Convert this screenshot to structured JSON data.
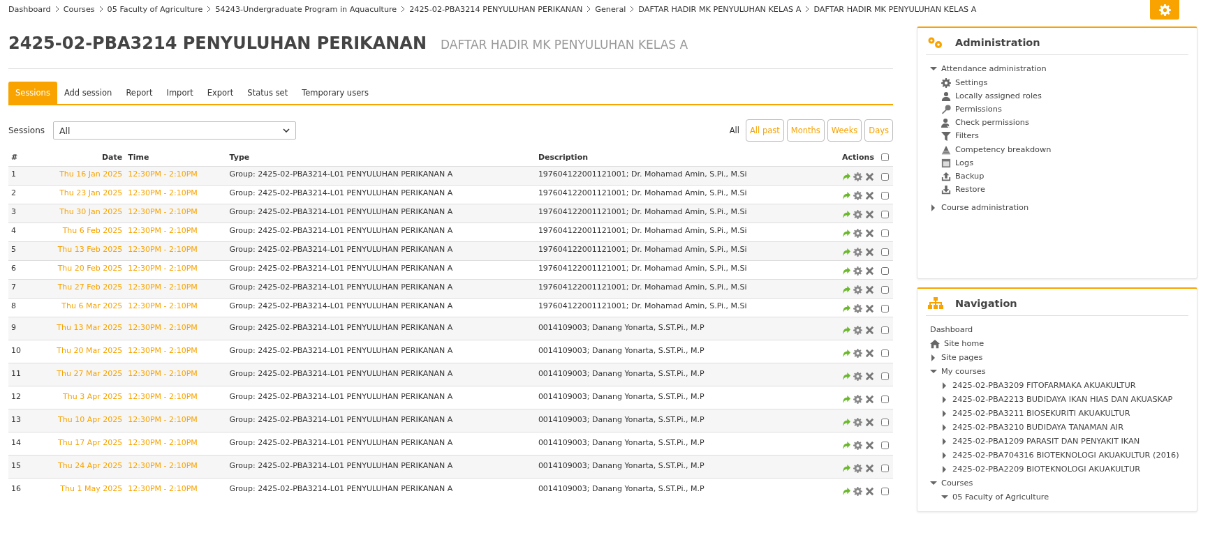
{
  "breadcrumb": [
    "Dashboard",
    "Courses",
    "05 Faculty of Agriculture",
    "54243-Undergraduate Program in Aquaculture",
    "2425-02-PBA3214 PENYULUHAN PERIKANAN",
    "General",
    "DAFTAR HADIR MK PENYULUHAN KELAS A",
    "DAFTAR HADIR MK PENYULUHAN KELAS A"
  ],
  "page_title": "2425-02-PBA3214 PENYULUHAN PERIKANAN",
  "page_subtitle": "DAFTAR HADIR MK PENYULUHAN KELAS A",
  "tabs": [
    {
      "label": "Sessions",
      "selected": true
    },
    {
      "label": "Add session",
      "selected": false
    },
    {
      "label": "Report",
      "selected": false
    },
    {
      "label": "Import",
      "selected": false
    },
    {
      "label": "Export",
      "selected": false
    },
    {
      "label": "Status set",
      "selected": false
    },
    {
      "label": "Temporary users",
      "selected": false
    }
  ],
  "filter": {
    "label": "Sessions",
    "value": "All"
  },
  "views": [
    {
      "label": "All",
      "selected": true
    },
    {
      "label": "All past",
      "selected": false
    },
    {
      "label": "Months",
      "selected": false
    },
    {
      "label": "Weeks",
      "selected": false
    },
    {
      "label": "Days",
      "selected": false
    }
  ],
  "table": {
    "columns": [
      "#",
      "Date",
      "Time",
      "Type",
      "Description",
      "Actions"
    ],
    "all_checked": false,
    "rows": [
      {
        "n": "1",
        "date": "Thu 16 Jan 2025",
        "time": "12:30PM - 2:10PM",
        "type": "Group: 2425-02-PBA3214-L01 PENYULUHAN PERIKANAN A",
        "description": "197604122001121001; Dr. Mohamad Amin, S.Pi., M.Si",
        "checked": false
      },
      {
        "n": "2",
        "date": "Thu 23 Jan 2025",
        "time": "12:30PM - 2:10PM",
        "type": "Group: 2425-02-PBA3214-L01 PENYULUHAN PERIKANAN A",
        "description": "197604122001121001; Dr. Mohamad Amin, S.Pi., M.Si",
        "checked": false
      },
      {
        "n": "3",
        "date": "Thu 30 Jan 2025",
        "time": "12:30PM - 2:10PM",
        "type": "Group: 2425-02-PBA3214-L01 PENYULUHAN PERIKANAN A",
        "description": "197604122001121001; Dr. Mohamad Amin, S.Pi., M.Si",
        "checked": false
      },
      {
        "n": "4",
        "date": "Thu 6 Feb 2025",
        "time": "12:30PM - 2:10PM",
        "type": "Group: 2425-02-PBA3214-L01 PENYULUHAN PERIKANAN A",
        "description": "197604122001121001; Dr. Mohamad Amin, S.Pi., M.Si",
        "checked": false
      },
      {
        "n": "5",
        "date": "Thu 13 Feb 2025",
        "time": "12:30PM - 2:10PM",
        "type": "Group: 2425-02-PBA3214-L01 PENYULUHAN PERIKANAN A",
        "description": "197604122001121001; Dr. Mohamad Amin, S.Pi., M.Si",
        "checked": false
      },
      {
        "n": "6",
        "date": "Thu 20 Feb 2025",
        "time": "12:30PM - 2:10PM",
        "type": "Group: 2425-02-PBA3214-L01 PENYULUHAN PERIKANAN A",
        "description": "197604122001121001; Dr. Mohamad Amin, S.Pi., M.Si",
        "checked": false
      },
      {
        "n": "7",
        "date": "Thu 27 Feb 2025",
        "time": "12:30PM - 2:10PM",
        "type": "Group: 2425-02-PBA3214-L01 PENYULUHAN PERIKANAN A",
        "description": "197604122001121001; Dr. Mohamad Amin, S.Pi., M.Si",
        "checked": false
      },
      {
        "n": "8",
        "date": "Thu 6 Mar 2025",
        "time": "12:30PM - 2:10PM",
        "type": "Group: 2425-02-PBA3214-L01 PENYULUHAN PERIKANAN A",
        "description": "197604122001121001; Dr. Mohamad Amin, S.Pi., M.Si",
        "checked": false
      },
      {
        "n": "9",
        "date": "Thu 13 Mar 2025",
        "time": "12:30PM - 2:10PM",
        "type": "Group: 2425-02-PBA3214-L01 PENYULUHAN PERIKANAN A",
        "description": "0014109003; Danang Yonarta, S.ST.Pi., M.P",
        "checked": false
      },
      {
        "n": "10",
        "date": "Thu 20 Mar 2025",
        "time": "12:30PM - 2:10PM",
        "type": "Group: 2425-02-PBA3214-L01 PENYULUHAN PERIKANAN A",
        "description": "0014109003; Danang Yonarta, S.ST.Pi., M.P",
        "checked": false
      },
      {
        "n": "11",
        "date": "Thu 27 Mar 2025",
        "time": "12:30PM - 2:10PM",
        "type": "Group: 2425-02-PBA3214-L01 PENYULUHAN PERIKANAN A",
        "description": "0014109003; Danang Yonarta, S.ST.Pi., M.P",
        "checked": false
      },
      {
        "n": "12",
        "date": "Thu 3 Apr 2025",
        "time": "12:30PM - 2:10PM",
        "type": "Group: 2425-02-PBA3214-L01 PENYULUHAN PERIKANAN A",
        "description": "0014109003; Danang Yonarta, S.ST.Pi., M.P",
        "checked": false
      },
      {
        "n": "13",
        "date": "Thu 10 Apr 2025",
        "time": "12:30PM - 2:10PM",
        "type": "Group: 2425-02-PBA3214-L01 PENYULUHAN PERIKANAN A",
        "description": "0014109003; Danang Yonarta, S.ST.Pi., M.P",
        "checked": false
      },
      {
        "n": "14",
        "date": "Thu 17 Apr 2025",
        "time": "12:30PM - 2:10PM",
        "type": "Group: 2425-02-PBA3214-L01 PENYULUHAN PERIKANAN A",
        "description": "0014109003; Danang Yonarta, S.ST.Pi., M.P",
        "checked": false
      },
      {
        "n": "15",
        "date": "Thu 24 Apr 2025",
        "time": "12:30PM - 2:10PM",
        "type": "Group: 2425-02-PBA3214-L01 PENYULUHAN PERIKANAN A",
        "description": "0014109003; Danang Yonarta, S.ST.Pi., M.P",
        "checked": false
      },
      {
        "n": "16",
        "date": "Thu 1 May 2025",
        "time": "12:30PM - 2:10PM",
        "type": "Group: 2425-02-PBA3214-L01 PENYULUHAN PERIKANAN A",
        "description": "0014109003; Danang Yonarta, S.ST.Pi., M.P",
        "checked": false
      }
    ]
  },
  "administration": {
    "title": "Administration",
    "items": [
      {
        "label": "Attendance administration",
        "expanded": true,
        "children": [
          {
            "label": "Settings",
            "kind": "gear"
          },
          {
            "label": "Locally assigned roles",
            "kind": "user"
          },
          {
            "label": "Permissions",
            "kind": "key"
          },
          {
            "label": "Check permissions",
            "kind": "usercheck"
          },
          {
            "label": "Filters",
            "kind": "filter"
          },
          {
            "label": "Competency breakdown",
            "kind": "pyramid"
          },
          {
            "label": "Logs",
            "kind": "logs"
          },
          {
            "label": "Backup",
            "kind": "upload"
          },
          {
            "label": "Restore",
            "kind": "download"
          }
        ]
      },
      {
        "label": "Course administration",
        "expanded": false
      }
    ]
  },
  "navigation": {
    "title": "Navigation",
    "items": [
      {
        "label": "Dashboard",
        "kind": "plain"
      },
      {
        "label": "Site home",
        "kind": "home"
      },
      {
        "label": "Site pages",
        "kind": "node",
        "expanded": false
      },
      {
        "label": "My courses",
        "kind": "node",
        "expanded": true,
        "children": [
          {
            "label": "2425-02-PBA3209 FITOFARMAKA AKUAKULTUR",
            "kind": "node",
            "expanded": false
          },
          {
            "label": "2425-02-PBA2213 BUDIDAYA IKAN HIAS DAN AKUASKAP",
            "kind": "node",
            "expanded": false
          },
          {
            "label": "2425-02-PBA3211 BIOSEKURITI AKUAKULTUR",
            "kind": "node",
            "expanded": false
          },
          {
            "label": "2425-02-PBA3210 BUDIDAYA TANAMAN AIR",
            "kind": "node",
            "expanded": false
          },
          {
            "label": "2425-02-PBA1209 PARASIT DAN PENYAKIT IKAN",
            "kind": "node",
            "expanded": false
          },
          {
            "label": "2425-02-PBA704316 BIOTEKNOLOGI AKUAKULTUR (2016)",
            "kind": "node",
            "expanded": false
          },
          {
            "label": "2425-02-PBA2209 BIOTEKNOLOGI AKUAKULTUR",
            "kind": "node",
            "expanded": false
          }
        ]
      },
      {
        "label": "Courses",
        "kind": "node",
        "expanded": true,
        "children": [
          {
            "label": "05 Faculty of Agriculture",
            "kind": "node",
            "expanded": true
          }
        ]
      }
    ]
  }
}
